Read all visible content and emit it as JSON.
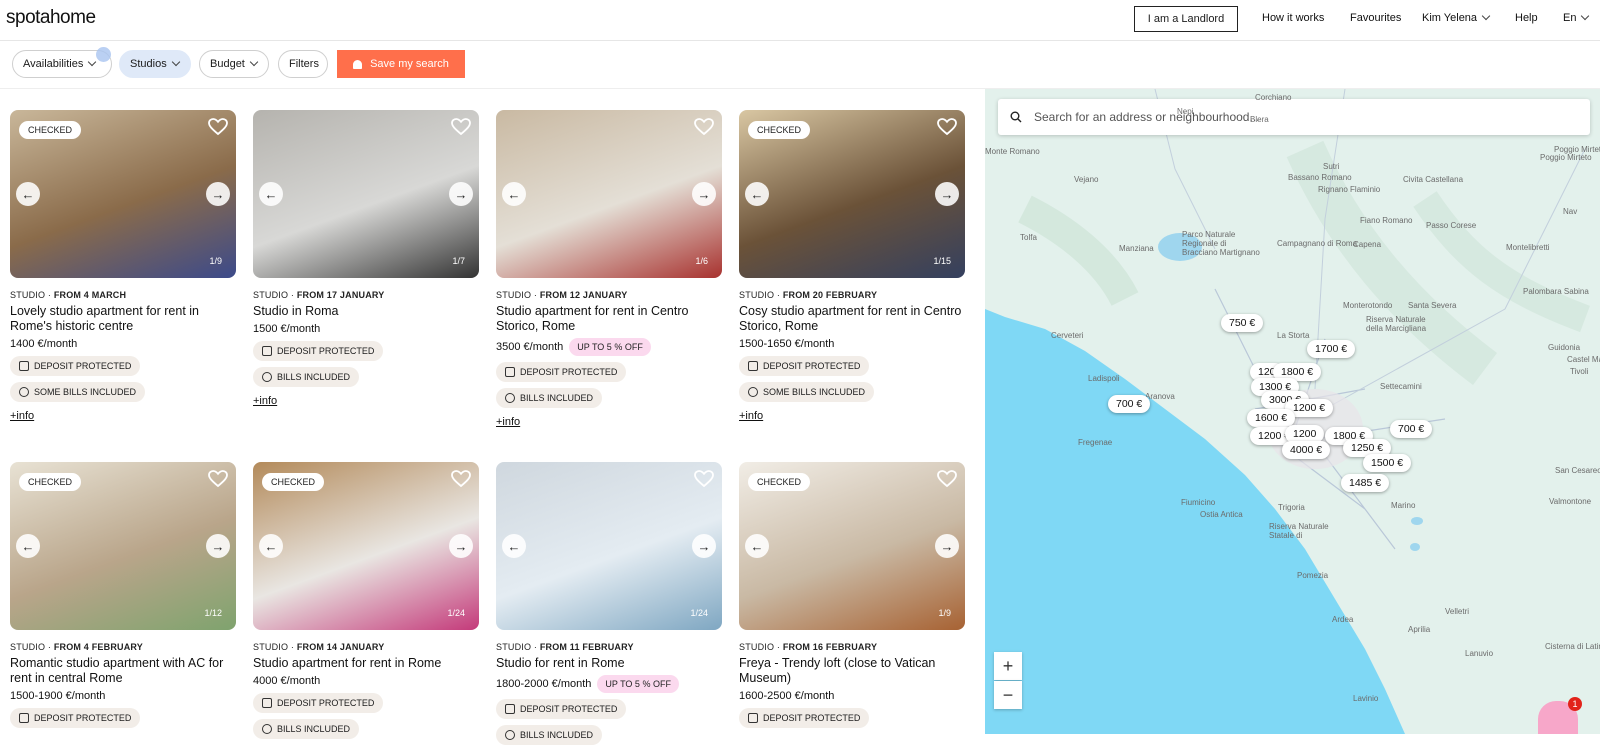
{
  "brand": "spotahome",
  "nav": {
    "landlord": "I am a Landlord",
    "how_it_works": "How it works",
    "favourites": "Favourites",
    "user": "Kim Yelena",
    "help": "Help",
    "lang": "En"
  },
  "filters": {
    "availabilities": "Availabilities",
    "studios": "Studios",
    "budget": "Budget",
    "filters": "Filters",
    "save": "Save my search"
  },
  "listings": [
    {
      "checked": "CHECKED",
      "type": "STUDIO",
      "from": "FROM 4 MARCH",
      "title": "Lovely studio apartment for rent in Rome's historic centre",
      "price": "1400 €",
      "unit": "/month",
      "tags": [
        "DEPOSIT PROTECTED",
        "SOME BILLS INCLUDED"
      ],
      "counter": "1/9",
      "info": "+info"
    },
    {
      "checked": "",
      "type": "STUDIO",
      "from": "FROM 17 JANUARY",
      "title": "Studio in Roma",
      "price": "1500 €",
      "unit": "/month",
      "tags": [
        "DEPOSIT PROTECTED",
        "BILLS INCLUDED"
      ],
      "counter": "1/7",
      "info": "+info"
    },
    {
      "checked": "",
      "type": "STUDIO",
      "from": "FROM 12 JANUARY",
      "title": "Studio apartment for rent in Centro Storico, Rome",
      "price": "3500 €",
      "unit": "/month",
      "off": "UP TO 5 % OFF",
      "tags": [
        "DEPOSIT PROTECTED",
        "BILLS INCLUDED"
      ],
      "counter": "1/6",
      "info": "+info"
    },
    {
      "checked": "CHECKED",
      "type": "STUDIO",
      "from": "FROM 20 FEBRUARY",
      "title": "Cosy studio apartment for rent in Centro Storico, Rome",
      "price": "1500-1650 €",
      "unit": "/month",
      "tags": [
        "DEPOSIT PROTECTED",
        "SOME BILLS INCLUDED"
      ],
      "counter": "1/15",
      "info": "+info"
    },
    {
      "checked": "CHECKED",
      "type": "STUDIO",
      "from": "FROM 4 FEBRUARY",
      "title": "Romantic studio apartment with AC for rent in central Rome",
      "price": "1500-1900 €",
      "unit": "/month",
      "tags": [
        "DEPOSIT PROTECTED"
      ],
      "counter": "1/12",
      "info": ""
    },
    {
      "checked": "CHECKED",
      "type": "STUDIO",
      "from": "FROM 14 JANUARY",
      "title": "Studio apartment for rent in Rome",
      "price": "4000 €",
      "unit": "/month",
      "tags": [
        "DEPOSIT PROTECTED",
        "BILLS INCLUDED"
      ],
      "counter": "1/24",
      "info": ""
    },
    {
      "checked": "",
      "type": "STUDIO",
      "from": "FROM 11 FEBRUARY",
      "title": "Studio for rent in Rome",
      "price": "1800-2000 €",
      "unit": "/month",
      "off": "UP TO 5 % OFF",
      "tags": [
        "DEPOSIT PROTECTED",
        "BILLS INCLUDED"
      ],
      "counter": "1/24",
      "info": ""
    },
    {
      "checked": "CHECKED",
      "type": "STUDIO",
      "from": "FROM 16 FEBRUARY",
      "title": "Freya - Trendy loft (close to Vatican Museum)",
      "price": "1600-2500 €",
      "unit": "/month",
      "tags": [
        "DEPOSIT PROTECTED"
      ],
      "counter": "1/9",
      "info": ""
    }
  ],
  "map": {
    "search_placeholder": "Search for an address or neighbourhood...",
    "markers": [
      "750 €",
      "1700 €",
      "120",
      "1800 €",
      "1300 €",
      "700 €",
      "3000 €",
      "1200 €",
      "1600 €",
      "1200 €",
      "1200",
      "1800 €",
      "700 €",
      "4000 €",
      "1250 €",
      "1500 €",
      "1485 €"
    ],
    "places": [
      "Corchiano",
      "Nepi",
      "Blera",
      "Monte Romano",
      "Sutri",
      "Bassano Romano",
      "Vejano",
      "Civita Castellana",
      "Poggio Mirteto",
      "Rignano Flaminio",
      "Tolfa",
      "Manziana",
      "Parco Naturale Regionale di Bracciano Martignano",
      "Campagnano di Roma",
      "Capena",
      "Fiano Romano",
      "Passo Corese",
      "Montelibretti",
      "Santa Severa",
      "Cerveteri",
      "Monterotondo",
      "La Storta",
      "Riserva Naturale della Marcigliana",
      "Palombara Sabina",
      "Guidonia",
      "Ladispoli",
      "Aranova",
      "Settecamini",
      "Castel Madama",
      "Tivoli",
      "Fregenae",
      "Fiumicino",
      "Ostia Antica",
      "Trigoria",
      "Riserva Naturale Statale di",
      "Pomezia",
      "Ardea",
      "Aprilia",
      "San Cesareo",
      "Valmontone",
      "Marino",
      "Velletri",
      "Lanuvio",
      "Cisterna di Latina",
      "Lavinio",
      "Poggio Mirteto",
      "Nav"
    ],
    "zoom_in": "+",
    "zoom_out": "−"
  },
  "chat_badge": "1"
}
